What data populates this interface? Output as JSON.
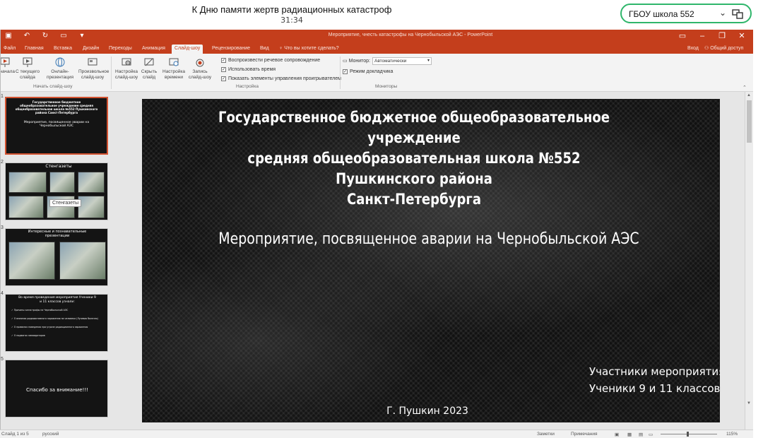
{
  "call": {
    "title": "К Дню памяти жертв радиационных катастроф",
    "time": "31:34",
    "room": "ГБОУ школа 552"
  },
  "window": {
    "title": "Мероприятие, чнесть катастрофы на Чернобыльской АЭС - PowerPoint",
    "tabs": [
      "Файл",
      "Главная",
      "Вставка",
      "Дизайн",
      "Переходы",
      "Анимация",
      "Слайд-шоу",
      "Рецензирование",
      "Вид"
    ],
    "active_tab": "Слайд-шоу",
    "tell_me": "Что вы хотите сделать?",
    "account": "Вход",
    "share": "Общий доступ"
  },
  "ribbon": {
    "buttons": [
      "С начала",
      "С текущего слайда",
      "Онлайн-презентация",
      "Произвольное слайд-шоу",
      "Настройка слайд-шоу",
      "Скрыть слайд",
      "Настройка времени",
      "Запись слайд-шоу"
    ],
    "groups": [
      "Начать слайд-шоу",
      "Настройка",
      "Мониторы"
    ],
    "checks": [
      {
        "label": "Воспроизвести речевое сопровождение",
        "checked": true
      },
      {
        "label": "Использовать время",
        "checked": true
      },
      {
        "label": "Показать элементы управления проигрывателем",
        "checked": true
      }
    ],
    "monitor_label": "Монитор:",
    "monitor_value": "Автоматически",
    "presenter_view": "Режим докладчика"
  },
  "thumbnails": {
    "numbers": [
      "1",
      "2",
      "3",
      "4",
      "5"
    ],
    "s1_title": "Государственное бюджетное общеобразовательное учреждение средняя общеобразовательная школа №552 Пушкинского района Санкт-Петербурга",
    "s1_subject": "Мероприятие, посвященное аварии на Чернобыльской АЭС",
    "s2_title": "Стенгазеты",
    "s3_title": "Интересные и познавательные презентации",
    "s4_title": "Во время проведения мероприятия Ученики 9 и 11 классов узнали:",
    "s4_items": [
      "Причины катастрофы на Чернобыльской АЭС",
      "О влиянии радиоактивного заражения на человека (Лучевая болезнь)",
      "О правилах поведения при угрозе радиационного заражения",
      "О подвигах ликвидаторов"
    ],
    "s5_title": "Спасибо за внимание!!!",
    "tooltip": "Стенгазеты"
  },
  "slide": {
    "title_lines": [
      "Государственное бюджетное общеобразовательное учреждение",
      "средняя общеобразовательная школа №552 Пушкинского района",
      "Санкт-Петербурга"
    ],
    "subject": "Мероприятие, посвященное аварии на Чернобыльской АЭС",
    "participants_line1": "Участники мероприятия :",
    "participants_line2": "Ученики 9 и 11 классов",
    "city_year": "Г. Пушкин 2023"
  },
  "status": {
    "slide_info": "Слайд 1 из 5",
    "language": "русский",
    "notes": "Заметки",
    "comments": "Примечания",
    "zoom": "115%"
  },
  "colors": {
    "ppt_accent": "#c43e1c",
    "room_border": "#2fb66b"
  }
}
